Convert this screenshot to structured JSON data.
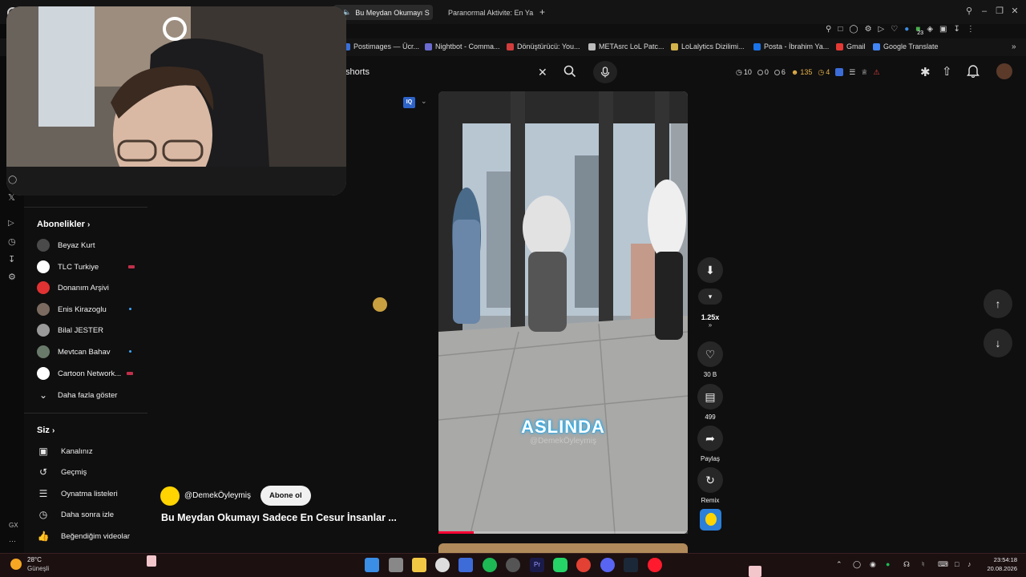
{
  "browser": {
    "tabs": [
      {
        "label": "Bu Meydan Okumayı S",
        "active": true
      },
      {
        "label": "Paranormal Aktivite: En Ya",
        "active": false
      }
    ],
    "new_tab": "+",
    "bookmarks": [
      {
        "label": "Postimages — Ücr...",
        "color": "#3a6fd8"
      },
      {
        "label": "Nightbot - Comma...",
        "color": "#6b6bd1"
      },
      {
        "label": "Dönüştürücü: You...",
        "color": "#d23c3c"
      },
      {
        "label": "METAsrc LoL Patc...",
        "color": "#bbbbbb"
      },
      {
        "label": "LoLalytics Dizilimi...",
        "color": "#d2b24a"
      },
      {
        "label": "Posta - İbrahim Ya...",
        "color": "#1a73e8"
      },
      {
        "label": "Gmail",
        "color": "#e53935"
      },
      {
        "label": "Google Translate",
        "color": "#4285f4"
      }
    ],
    "ext_badge": "23"
  },
  "header": {
    "search_value": "shorts",
    "stats": [
      {
        "icon": "clock-icon",
        "value": "10",
        "color": "#dddddd"
      },
      {
        "icon": "eye-icon",
        "value": "0",
        "color": "#dddddd"
      },
      {
        "icon": "eye-icon",
        "value": "6",
        "color": "#dddddd"
      },
      {
        "icon": "person-icon",
        "value": "135",
        "color": "#e9b44c"
      },
      {
        "icon": "clock-icon",
        "value": "4",
        "color": "#e9b44c"
      }
    ]
  },
  "sidebar": {
    "subscriptions_title": "Abonelikler",
    "subscriptions": [
      {
        "name": "Beyaz Kurt",
        "avatar_color": "#4a4a4a",
        "indicator": ""
      },
      {
        "name": "TLC Turkiye",
        "avatar_color": "#ffffff",
        "indicator": "live"
      },
      {
        "name": "Donanım Arşivi",
        "avatar_color": "#e03232",
        "indicator": ""
      },
      {
        "name": "Enis Kirazoglu",
        "avatar_color": "#7a6a60",
        "indicator": "new"
      },
      {
        "name": "Bilal JESTER",
        "avatar_color": "#9a9a9a",
        "indicator": ""
      },
      {
        "name": "Mevtcan Bahav",
        "avatar_color": "#6a7a6a",
        "indicator": "new"
      },
      {
        "name": "Cartoon Network...",
        "avatar_color": "#ffffff",
        "indicator": "live"
      }
    ],
    "show_more": "Daha fazla göster",
    "you_title": "Siz",
    "you_items": [
      {
        "label": "Kanalınız",
        "icon": "channel-icon"
      },
      {
        "label": "Geçmiş",
        "icon": "history-icon"
      },
      {
        "label": "Oynatma listeleri",
        "icon": "playlist-icon"
      },
      {
        "label": "Daha sonra izle",
        "icon": "watch-later-icon"
      },
      {
        "label": "Beğendiğim videolar",
        "icon": "like-icon"
      }
    ],
    "rail_bottom": "GX"
  },
  "short": {
    "caption": "ASLINDA",
    "watermark": "@DemekÖyleymiş",
    "channel": "@DemekÖyleymiş",
    "subscribe_label": "Abone ol",
    "title": "Bu Meydan Okumayı Sadece En Cesur İnsanlar ...",
    "progress": 0.14,
    "speed": "1.25x",
    "likes": "30 B",
    "comments": "499",
    "share": "Paylaş",
    "remix": "Remix"
  },
  "taskbar": {
    "weather_temp": "28°C",
    "weather_desc": "Güneşli",
    "time": "23:54:18",
    "date": "20.08.2026"
  }
}
